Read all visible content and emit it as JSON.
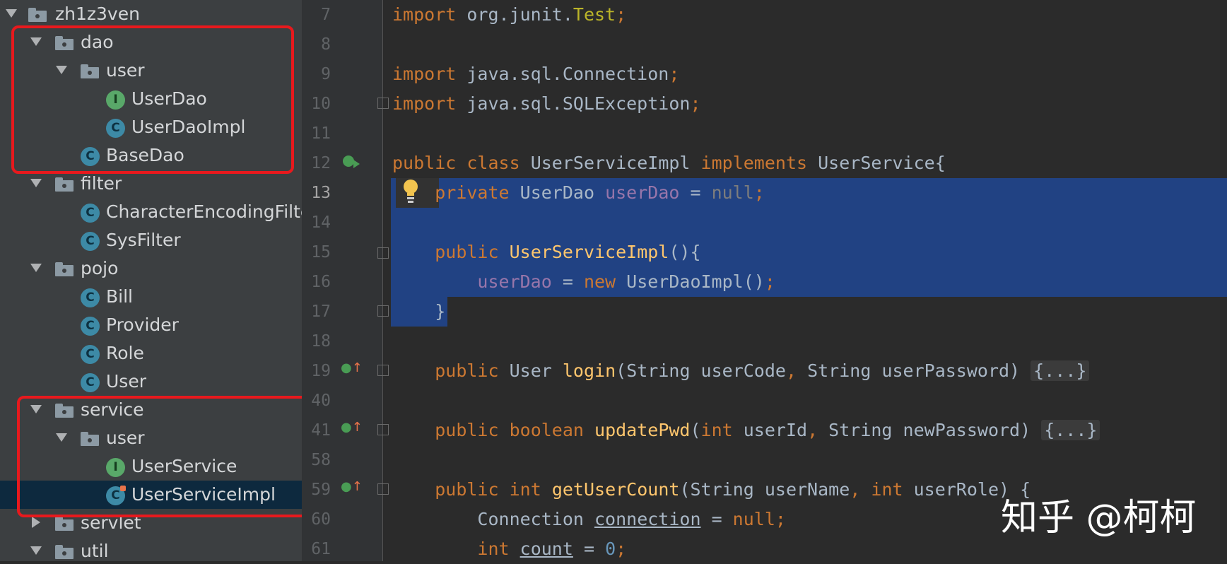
{
  "tree": {
    "items": [
      {
        "label": "zh1z3ven",
        "kind": "folder"
      },
      {
        "label": "dao",
        "kind": "folder"
      },
      {
        "label": "user",
        "kind": "folder"
      },
      {
        "label": "UserDao",
        "kind": "interface",
        "icon_letter": "I"
      },
      {
        "label": "UserDaoImpl",
        "kind": "class",
        "icon_letter": "C"
      },
      {
        "label": "BaseDao",
        "kind": "class",
        "icon_letter": "C"
      },
      {
        "label": "filter",
        "kind": "folder"
      },
      {
        "label": "CharacterEncodingFilter",
        "kind": "class",
        "icon_letter": "C"
      },
      {
        "label": "SysFilter",
        "kind": "class",
        "icon_letter": "C"
      },
      {
        "label": "pojo",
        "kind": "folder"
      },
      {
        "label": "Bill",
        "kind": "class",
        "icon_letter": "C"
      },
      {
        "label": "Provider",
        "kind": "class",
        "icon_letter": "C"
      },
      {
        "label": "Role",
        "kind": "class",
        "icon_letter": "C"
      },
      {
        "label": "User",
        "kind": "class",
        "icon_letter": "C"
      },
      {
        "label": "service",
        "kind": "folder"
      },
      {
        "label": "user",
        "kind": "folder"
      },
      {
        "label": "UserService",
        "kind": "interface",
        "icon_letter": "I"
      },
      {
        "label": "UserServiceImpl",
        "kind": "class",
        "icon_letter": "C",
        "selected": true
      },
      {
        "label": "servlet",
        "kind": "folder",
        "collapsed": true
      },
      {
        "label": "util",
        "kind": "folder"
      }
    ]
  },
  "editor": {
    "line_numbers": [
      "7",
      "8",
      "9",
      "10",
      "11",
      "12",
      "13",
      "14",
      "15",
      "16",
      "17",
      "18",
      "19",
      "40",
      "41",
      "58",
      "59",
      "60",
      "61"
    ],
    "current_line": "13",
    "code": {
      "l7": {
        "kw": "import",
        "rest": " org.junit.",
        "ann": "Test",
        "semi": ";"
      },
      "l9": {
        "kw": "import",
        "rest": " java.sql.Connection",
        "semi": ";"
      },
      "l10": {
        "kw": "import",
        "rest": " java.sql.SQLException",
        "semi": ";"
      },
      "l12": {
        "kw1": "public",
        "kw2": "class",
        "name": "UserServiceImpl",
        "kw3": "implements",
        "iface": "UserService{"
      },
      "l13": {
        "kw": "private",
        "type": "UserDao",
        "field": "userDao",
        "eq": " = ",
        "nul": "null",
        "semi": ";"
      },
      "l15": {
        "kw": "public",
        "fn": "UserServiceImpl",
        "rest": "(){"
      },
      "l16": {
        "field": "userDao",
        "eq": " = ",
        "kw": "new",
        "rest": " UserDaoImpl()",
        "semi": ";"
      },
      "l17": {
        "brace": "}"
      },
      "l19": {
        "kw": "public",
        "type": "User",
        "fn": "login",
        "p1": "(String userCode",
        "comma": ",",
        "p2": " String userPassword) ",
        "fold": "{...}"
      },
      "l41": {
        "kw": "public",
        "kw2": "boolean",
        "fn": "updatePwd",
        "p0": "(",
        "kw3": "int",
        "p1": " userId",
        "comma": ",",
        "p2": " String newPassword) ",
        "fold": "{...}"
      },
      "l59": {
        "kw": "public",
        "kw2": "int",
        "fn": "getUserCount",
        "p1": "(String userName",
        "comma": ",",
        "kw3": "int",
        "p2": " userRole) {"
      },
      "l60": {
        "type": "Connection",
        "var": "connection",
        "eq": " = ",
        "nul": "null",
        "semi": ";"
      },
      "l61": {
        "kw": "int",
        "var": "count",
        "eq": " = ",
        "num": "0",
        "semi": ";"
      }
    }
  },
  "watermark": "知乎 @柯柯",
  "colors": {
    "highlight_box": "#e8191d",
    "selection": "#214283",
    "keyword": "#cc7832",
    "field": "#9876aa",
    "function": "#ffc66d"
  }
}
